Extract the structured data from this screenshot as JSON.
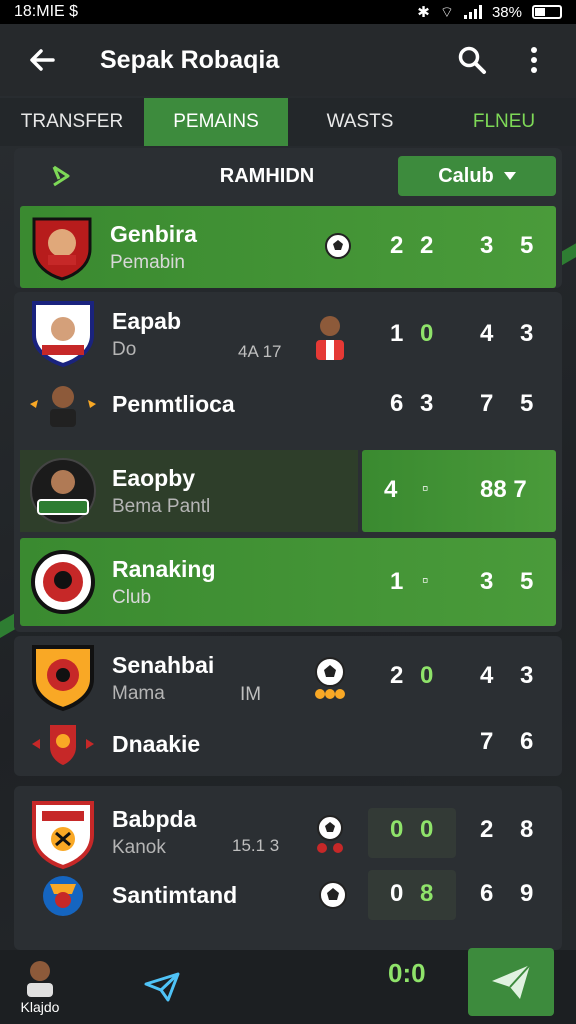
{
  "status": {
    "time": "18:MIE $",
    "battery": "38%"
  },
  "appbar": {
    "title": "Sepak Robaqia"
  },
  "tabs": [
    {
      "label": "TRANSFER",
      "active": false
    },
    {
      "label": "PEMAINS",
      "active": true
    },
    {
      "label": "WASTS",
      "active": false
    },
    {
      "label": "FLNEU",
      "active": false
    }
  ],
  "filter": {
    "label": "RAMHIDN",
    "select_value": "Calub"
  },
  "rows": [
    {
      "main": "Genbira",
      "sub": "Pemabin",
      "s1": "2",
      "s2": "2",
      "s3": "3",
      "s4": "5"
    },
    {
      "main": "Eapab",
      "sub": "Do",
      "mid": "4A 17",
      "s1": "1",
      "s2": "0",
      "s3": "4",
      "s4": "3"
    },
    {
      "main": "Penmtlioca",
      "s1": "6",
      "s2": "3",
      "s3": "7",
      "s4": "5"
    },
    {
      "main": "Eaopby",
      "sub": "Bema Pantl",
      "s1": "4",
      "s2": "▫",
      "s3": "88 7"
    },
    {
      "main": "Ranaking",
      "sub": "Club",
      "s1": "1",
      "s2": "▫",
      "s3": "3",
      "s4": "5"
    },
    {
      "main": "Senahbai",
      "sub": "Mama",
      "mid": "IM",
      "s1": "2",
      "s2": "0",
      "s3": "4",
      "s4": "3"
    },
    {
      "main": "Dnaakie",
      "s3": "7",
      "s4": "6"
    },
    {
      "main": "Babpda",
      "sub": "Kanok",
      "mid": "15.1 3",
      "s1": "0",
      "s2": "0",
      "s3": "2",
      "s4": "8"
    },
    {
      "main": "Santimtand",
      "s1": "0",
      "s2": "8",
      "s3": "6",
      "s4": "9"
    }
  ],
  "bottom": {
    "profile_label": "Klajdo",
    "score": "0:0"
  },
  "colors": {
    "accent": "#3d8b3d",
    "accent_text": "#8fe36a",
    "panel": "#2b2f33"
  }
}
